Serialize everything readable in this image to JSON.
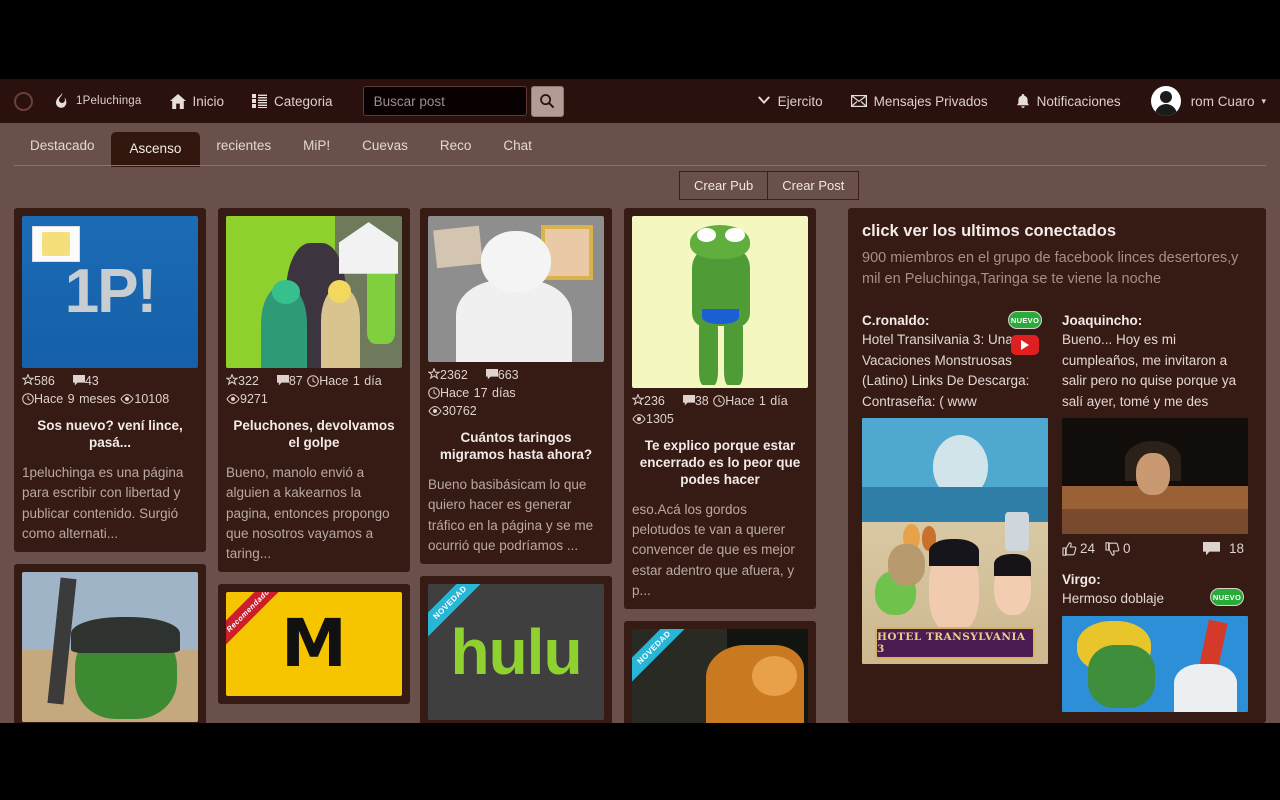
{
  "navbar": {
    "brand_icon": "flame-icon",
    "brand": "1Peluchinga",
    "home": "Inicio",
    "category": "Categoria",
    "search_placeholder": "Buscar post",
    "search_value": "",
    "army": "Ejercito",
    "messages": "Mensajes Privados",
    "notifications": "Notificaciones",
    "user": "rom Cuaro",
    "caret": "▾"
  },
  "tabs": [
    {
      "label": "Destacado",
      "active": false
    },
    {
      "label": "Ascenso",
      "active": true
    },
    {
      "label": "recientes",
      "active": false
    },
    {
      "label": "MiP!",
      "active": false
    },
    {
      "label": "Cuevas",
      "active": false
    },
    {
      "label": "Reco",
      "active": false
    },
    {
      "label": "Chat",
      "active": false
    }
  ],
  "actions": {
    "create_pub": "Crear Pub",
    "create_post": "Crear Post"
  },
  "posts": [
    {
      "thumb": "1P!",
      "stars": "586",
      "comments": "43",
      "time": "Hace 9 meses",
      "views": "10108",
      "title": "Sos nuevo? vení lince, pasá...",
      "excerpt": "1peluchinga es una página para escribir con libertad y publicar contenido. Surgió como alternati..."
    },
    {
      "stars": "322",
      "comments": "87",
      "time": "Hace 1 día",
      "views": "9271",
      "title": "Peluchones, devolvamos el golpe",
      "excerpt": "Bueno, manolo envió a alguien a kakearnos la pagina, entonces propongo que nosotros vayamos a taring..."
    },
    {
      "stars": "2362",
      "comments": "663",
      "time": "Hace 17 días",
      "views": "30762",
      "title": "Cuántos taringos migramos hasta ahora?",
      "excerpt": "Bueno basibásicam lo que quiero hacer es generar tráfico en la página y se me ocurrió que podríamos ..."
    },
    {
      "stars": "236",
      "comments": "38",
      "time": "Hace 1 día",
      "views": "1305",
      "title": "Te explico porque estar encerrado es lo peor que podes hacer",
      "excerpt": "eso.Acá los gordos pelotudos te van a querer convencer de que es mejor estar adentro que afuera, y p..."
    }
  ],
  "partial_cards": {
    "ribbon_recomendado": "Recomendado",
    "ribbon_novedad": "NOVEDAD",
    "hulu_text": "hulu",
    "m_text": "M"
  },
  "sidebar": {
    "title": "click ver los ultimos conectados",
    "subtitle": "900 miembros en el grupo de facebook linces desertores,y mil en Peluchinga,Taringa se te viene la noche",
    "badge_new": "NUEVO",
    "entries": [
      {
        "user": "C.ronaldo:",
        "text": "Hotel Transilvania 3: Unas Vacaciones Monstruosas (Latino) Links De Descarga: Contraseña: ( www",
        "image": "hotel-transylvania-3-poster",
        "caption": "HOTEL TRANSYLVANIA 3"
      },
      {
        "user": "Joaquincho:",
        "text": "Bueno... Hoy es mi cumpleaños, me invitaron a salir pero no quise porque ya salí ayer, tomé y me des",
        "image": "feast-photo",
        "likes": "24",
        "dislikes": "0",
        "comments": "18"
      },
      {
        "user": "Virgo:",
        "text": "Hermoso doblaje",
        "image": "anime-screenshot"
      }
    ]
  },
  "colors": {
    "navbar_bg": "#2a110d",
    "page_bg": "#6a504a",
    "card_bg": "#361a14",
    "active_tab_bg": "#32170f",
    "text": "#e6ddd9",
    "muted": "#b9a9a3",
    "badge_green": "#2aaa3a",
    "youtube_red": "#e02020",
    "ribbon_cyan": "#27b6d6",
    "ribbon_red": "#cc1f2c"
  }
}
